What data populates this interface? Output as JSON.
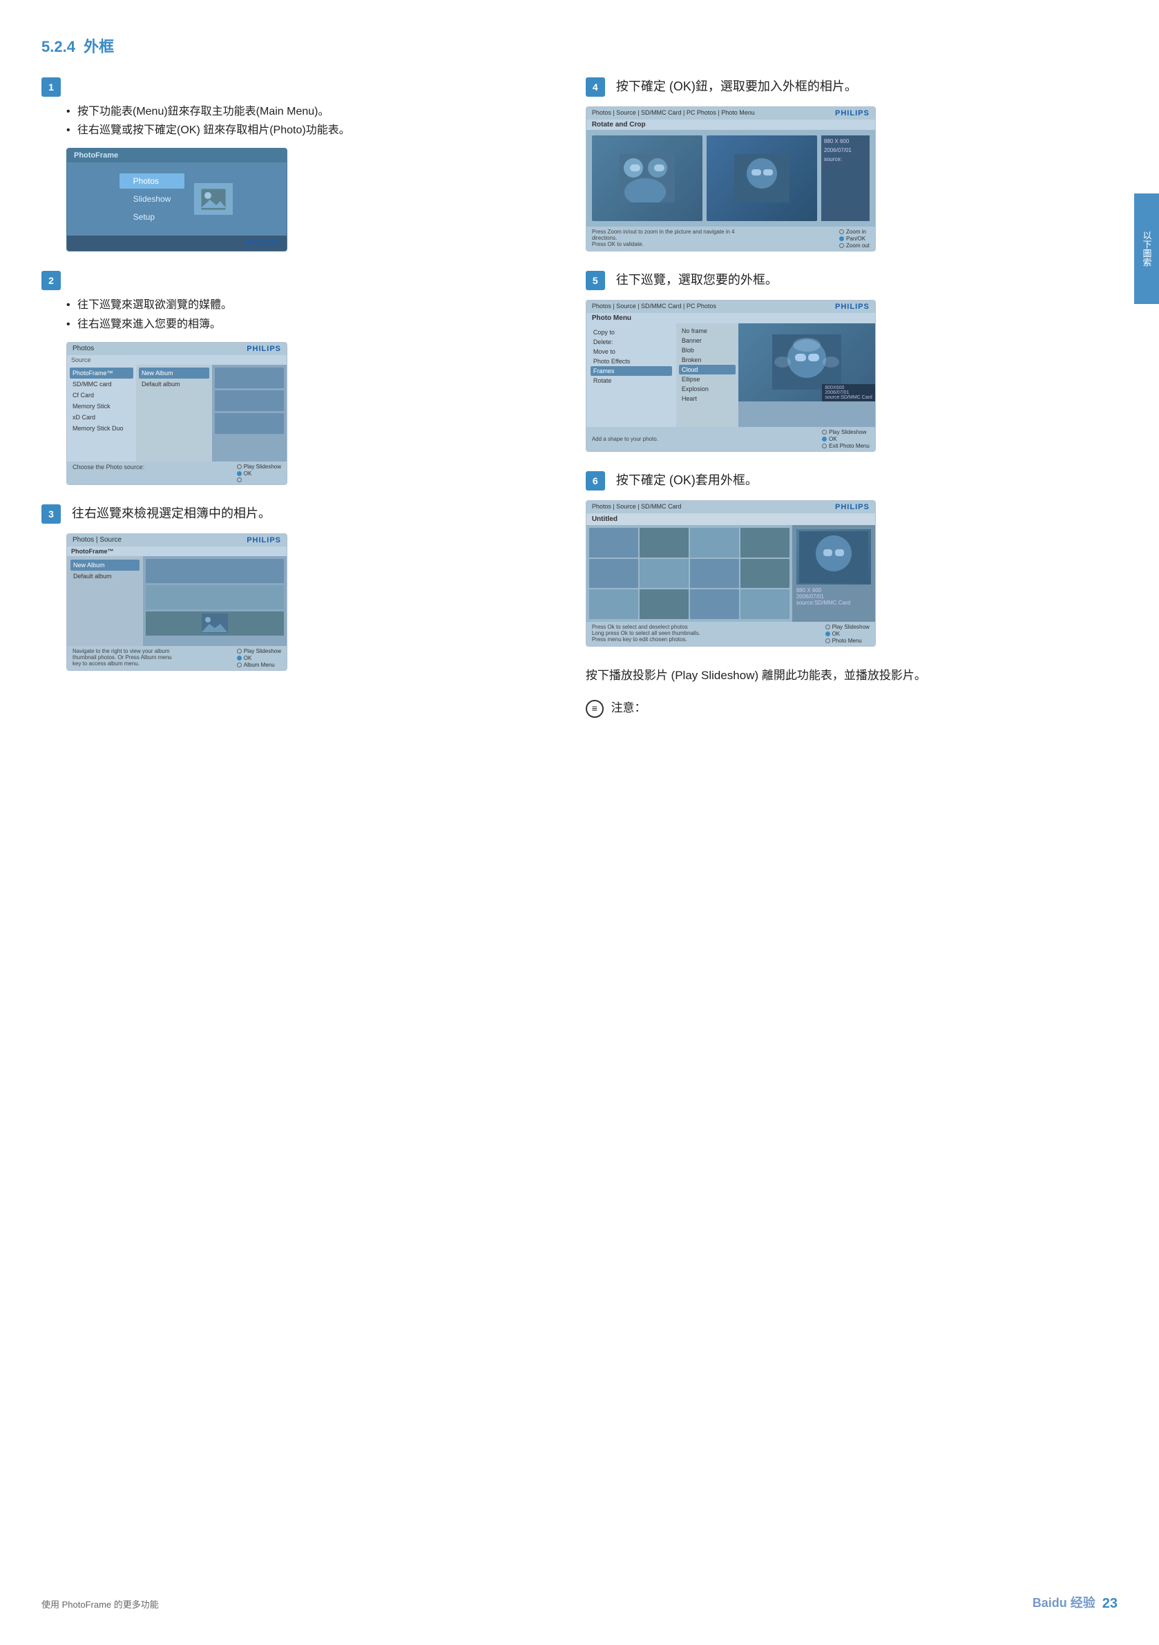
{
  "page": {
    "title": "5.2.4  外框",
    "side_tab_text": "以下圖索",
    "footer_left": "使用 PhotoFrame 的更多功能",
    "page_number": "23",
    "baidu_text": "Baidu 经验"
  },
  "section": {
    "number": "5.2.4",
    "title": "外框"
  },
  "steps": {
    "step1": {
      "number": "1",
      "bullets": [
        "按下功能表(Menu)鈕來存取主功能表(Main Menu)。",
        "往右巡覽或按下確定(OK) 鈕來存取相片(Photo)功能表。"
      ]
    },
    "step2": {
      "number": "2",
      "bullets": [
        "往下巡覽來選取欲瀏覽的媒體。",
        "往右巡覽來進入您要的相簿。"
      ]
    },
    "step3": {
      "number": "3",
      "text": "往右巡覽來檢視選定相簿中的相片。"
    },
    "step4": {
      "number": "4",
      "text": "按下確定 (OK)鈕，選取要加入外框的相片。"
    },
    "step5": {
      "number": "5",
      "text": "往下巡覽，選取您要的外框。"
    },
    "step6": {
      "number": "6",
      "text": "按下確定 (OK)套用外框。"
    }
  },
  "screens": {
    "photoframe_main": {
      "title": "PhotoFrame",
      "menu_items": [
        "Photos",
        "Slideshow",
        "Setup"
      ],
      "active_item": "Photos",
      "philips_logo": "PHILIPS"
    },
    "source_screen": {
      "header": "Photos",
      "philips": "PHILIPS",
      "section_title": "Source",
      "left_items": [
        "PhotoFrame™",
        "SD/MMC card",
        "Cf Card",
        "Memory Stick",
        "xD Card",
        "Memory Stick Duo"
      ],
      "active_left": "PhotoFrame™",
      "right_items": [
        "New Album",
        "Default album"
      ],
      "active_right": "New Album",
      "footer_text": "Choose the Photo source:",
      "controls": [
        "Play Slideshow",
        "OK"
      ]
    },
    "album_screen": {
      "header": "Photos | Source",
      "philips": "PHILIPS",
      "section_title": "PhotoFrame™",
      "album_items": [
        "New Album",
        "Default album"
      ],
      "active_album": "New Album",
      "footer_nav": "Navigate to the right to view your album thumbnail photos. Or Press Album menu key to access album menu.",
      "controls": [
        "Play Slideshow",
        "OK",
        "Album Menu"
      ]
    },
    "rotate_crop": {
      "header": "Photos | Source | SD/MMC Card | PC Photos | Photo Menu",
      "philips": "PHILIPS",
      "title": "Rotate and Crop",
      "info": "880 X 600\n2006/07/01\nsource:",
      "footer_text": "Press Zoom in/out to zoom in the picture and navigate in 4 directions.\nPress OK to validate.",
      "controls": [
        "Zoom in",
        "Pan/OK",
        "Zoom out"
      ]
    },
    "frames_screen": {
      "header": "Photos | Source | SD/MMC Card | PC Photos",
      "philips": "PHILIPS",
      "title": "Photo Menu",
      "left_items": [
        "Copy to",
        "Delete:",
        "Move to",
        "Photo Effects",
        "Frames",
        "Rotate"
      ],
      "active_left": "Frames",
      "right_items": [
        "No frame",
        "Banner",
        "Blob",
        "Broken",
        "Cloud",
        "Ellipse",
        "Explosion",
        "Heart"
      ],
      "active_right": "Cloud",
      "info": "800X600\n2006/07/01\nsource:SD/MMC Card",
      "add_text": "Add a shape to your photo.",
      "controls": [
        "Play Slideshow",
        "OK",
        "Exit Photo Menu"
      ]
    },
    "photo_grid": {
      "header": "Photos | Source | SD/MMC Card",
      "philips": "PHILIPS",
      "title": "Untitled",
      "info": "880 X 600\n2006/07/01\nsource:SD/MMC Card",
      "footer_text1": "Press Ok to select and deselect photos",
      "footer_text2": "Long press Ok to select all seen thumbnails.",
      "footer_text3": "Press menu key to edit chosen photos.",
      "controls": [
        "Play Slideshow",
        "OK",
        "Photo Menu"
      ]
    }
  },
  "bottom": {
    "slideshow_text": "按下播放投影片 (Play Slideshow) 離開此功能表，並播放投影片。",
    "note_label": "注意："
  }
}
